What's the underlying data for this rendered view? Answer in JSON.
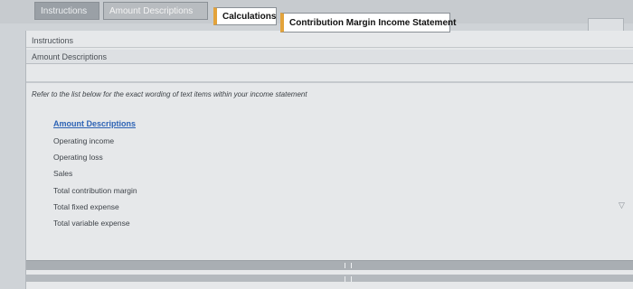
{
  "tabs": {
    "instructions": "Instructions",
    "amount_descriptions": "Amount Descriptions",
    "calculations": "Calculations",
    "cmis": "Contribution Margin Income Statement"
  },
  "breadcrumbs": [
    "Instructions",
    "Amount Descriptions"
  ],
  "content": {
    "instruction": "Refer to the list below for the exact wording of text items within your income statement",
    "list_header": "Amount Descriptions",
    "items": [
      "Operating income",
      "Operating loss",
      "Sales",
      "Total contribution margin",
      "Total fixed expense",
      "Total variable expense"
    ]
  },
  "colors": {
    "accent_tab": "#e3a33b",
    "link": "#2d63b5"
  }
}
